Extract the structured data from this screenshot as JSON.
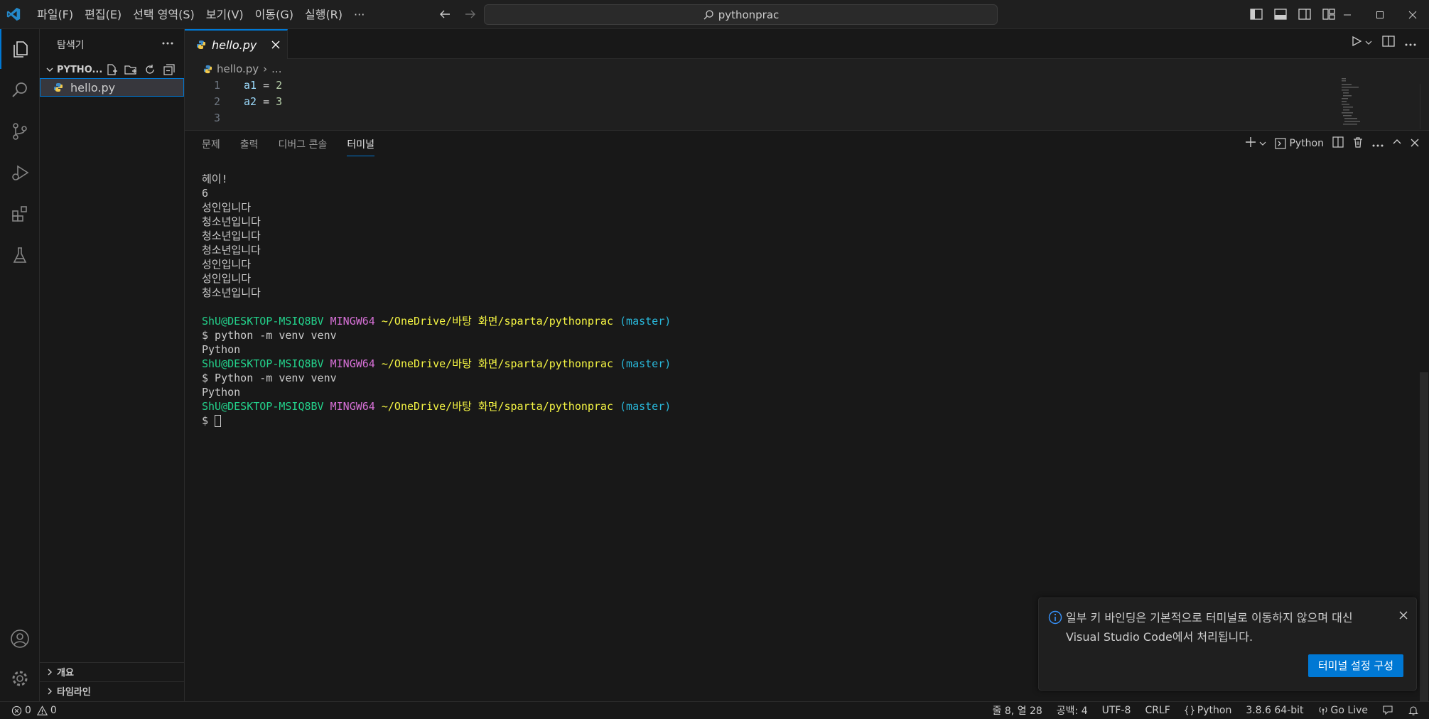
{
  "title_bar": {
    "menu": [
      "파일(F)",
      "편집(E)",
      "선택 영역(S)",
      "보기(V)",
      "이동(G)",
      "실행(R)"
    ],
    "more": "···",
    "search_text": "pythonprac"
  },
  "sidebar": {
    "title": "탐색기",
    "folder_name": "PYTHO...",
    "files": [
      "hello.py"
    ],
    "sections": [
      "개요",
      "타임라인"
    ]
  },
  "editor": {
    "tab_label": "hello.py",
    "breadcrumb_file": "hello.py",
    "breadcrumb_more": "...",
    "lines": [
      {
        "num": "1",
        "var": "a1",
        "op": " = ",
        "val": "2"
      },
      {
        "num": "2",
        "var": "a2",
        "op": " = ",
        "val": "3"
      },
      {
        "num": "3",
        "var": "",
        "op": "",
        "val": ""
      }
    ]
  },
  "panel": {
    "tabs": [
      "문제",
      "출력",
      "디버그 콘솔",
      "터미널"
    ],
    "active_tab": "터미널",
    "terminal_name": "Python",
    "output_lines": [
      "헤이!",
      "6",
      "성인입니다",
      "청소년입니다",
      "청소년입니다",
      "청소년입니다",
      "성인입니다",
      "성인입니다",
      "청소년입니다"
    ],
    "prompt": {
      "user": "ShU@DESKTOP-MSIQ8BV",
      "host": "MINGW64",
      "path": "~/OneDrive/바탕 화면/sparta/pythonprac",
      "branch": "(master)"
    },
    "commands": [
      {
        "cmd": "$ python -m venv venv",
        "out": "Python"
      },
      {
        "cmd": "$ Python -m venv venv",
        "out": "Python"
      }
    ],
    "final_prompt": "$ "
  },
  "notification": {
    "message_line1": "일부 키 바인딩은 기본적으로 터미널로 이동하지 않으며 대신",
    "message_line2": "Visual Studio Code에서 처리됩니다.",
    "button": "터미널 설정 구성"
  },
  "status_bar": {
    "errors": "0",
    "warnings": "0",
    "position": "줄 8, 열 28",
    "indent": "공백: 4",
    "encoding": "UTF-8",
    "eol": "CRLF",
    "language": "Python",
    "interpreter": "3.8.6 64-bit",
    "live": "Go Live"
  },
  "colors": {
    "accent": "#0078d4",
    "prompt_user": "#23d18b",
    "prompt_host": "#d670d6",
    "prompt_path": "#f5f543",
    "prompt_branch": "#29b8db"
  }
}
